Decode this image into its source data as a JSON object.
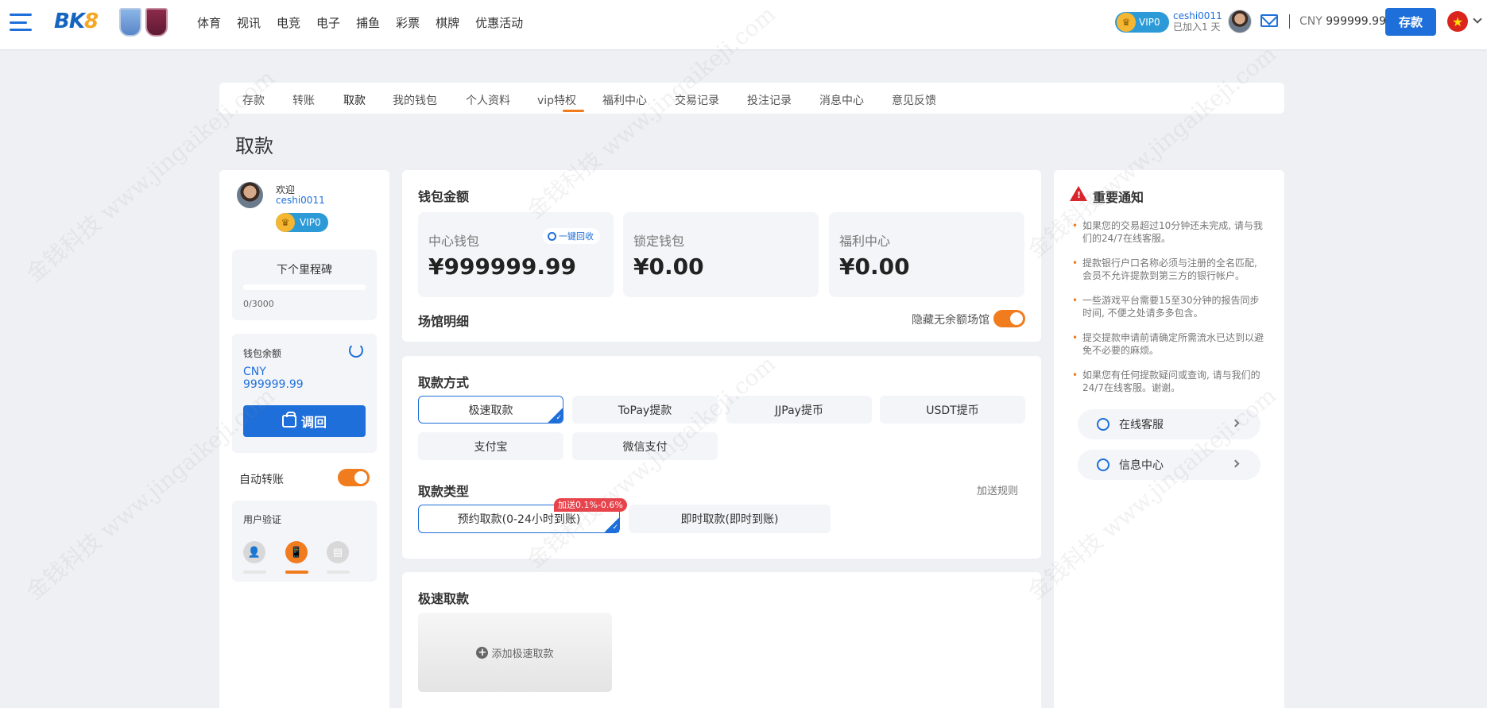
{
  "header": {
    "logo_main": "BK",
    "logo_num": "8",
    "nav": [
      "体育",
      "视讯",
      "电竞",
      "电子",
      "捕鱼",
      "彩票",
      "棋牌",
      "优惠活动"
    ],
    "vip_label": "VIP0",
    "username": "ceshi0011",
    "joined": "已加入1 天",
    "currency": "CNY",
    "balance": "999999.99",
    "deposit_label": "存款",
    "flag_star": "★"
  },
  "tabs": [
    "存款",
    "转账",
    "取款",
    "我的钱包",
    "个人资料",
    "vip特权",
    "福利中心",
    "交易记录",
    "投注记录",
    "消息中心",
    "意见反馈"
  ],
  "page_title": "取款",
  "left": {
    "welcome": "欢迎",
    "username": "ceshi0011",
    "vip_label": "VIP0",
    "milestone_title": "下个里程碑",
    "milestone_progress": 0,
    "milestone_count": "0/3000",
    "wallet_label": "钱包余额",
    "wallet_currency": "CNY",
    "wallet_amount": "999999.99",
    "recall_label": "调回",
    "auto_transfer_label": "自动转账",
    "auto_transfer_on": true,
    "verify_label": "用户验证",
    "verify_icons": [
      "👤",
      "📱",
      "▤"
    ]
  },
  "wallet": {
    "title": "钱包金额",
    "boxes": [
      {
        "label": "中心钱包",
        "amount": "¥999999.99"
      },
      {
        "label": "锁定钱包",
        "amount": "¥0.00"
      },
      {
        "label": "福利中心",
        "amount": "¥0.00"
      }
    ],
    "one_click": "一键回收",
    "venue_title": "场馆明细",
    "hide_label": "隐藏无余额场馆",
    "hide_on": true
  },
  "method": {
    "title": "取款方式",
    "options": [
      "极速取款",
      "ToPay提款",
      "JJPay提币",
      "USDT提币",
      "支付宝",
      "微信支付"
    ],
    "selected": "极速取款",
    "type_title": "取款类型",
    "add_rules": "加送规则",
    "types": [
      "预约取款(0-24小时到账)",
      "即时取款(即时到账)"
    ],
    "bonus_badge": "加送0.1%-0.6%"
  },
  "fast": {
    "title": "极速取款",
    "add_label": "添加极速取款",
    "plus": "+"
  },
  "notice": {
    "title": "重要通知",
    "warn_mark": "!",
    "items": [
      "如果您的交易超过10分钟还未完成, 请与我们的24/7在线客服。",
      "提款银行户口名称必须与注册的全名匹配, 会员不允许提款到第三方的银行帐户。",
      "一些游戏平台需要15至30分钟的报告同步时间, 不便之处请多多包含。",
      "提交提款申请前请确定所需流水已达到以避免不必要的麻烦。",
      "如果您有任何提款疑问或查询, 请与我们的24/7在线客服。谢谢。"
    ],
    "online_service": "在线客服",
    "info_center": "信息中心"
  },
  "colors": {
    "brand_blue": "#1e6fd9",
    "accent_orange": "#f07c1e",
    "badge_red": "#e8424a"
  },
  "watermark": "金钱科技 www.jingaikeji.com"
}
